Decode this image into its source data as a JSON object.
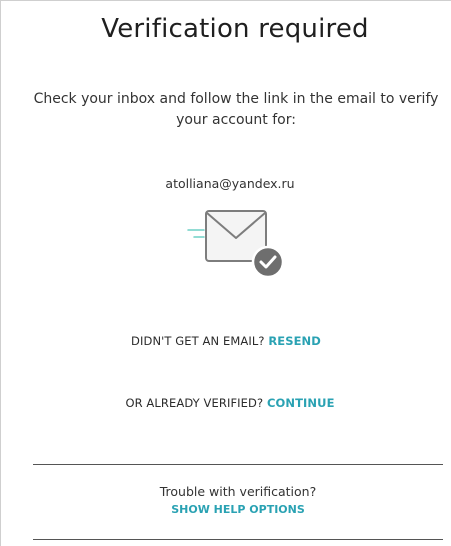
{
  "title": "Verification required",
  "instructions": "Check your inbox and follow the link in the email to verify your account for:",
  "email": "atolliana@yandex.ru",
  "illustration": {
    "icon": "envelope-check-icon",
    "colors": {
      "envelope_stroke": "#7d7d7d",
      "envelope_fill": "#f4f4f4",
      "check_circle": "#6e6e6e",
      "speed_lines": "#6fd0c6"
    }
  },
  "resend": {
    "prompt": "DIDN'T GET AN EMAIL?",
    "link": "RESEND"
  },
  "continue": {
    "prompt": "OR ALREADY VERIFIED?",
    "link": "CONTINUE"
  },
  "help": {
    "prompt": "Trouble with verification?",
    "link": "SHOW HELP OPTIONS"
  },
  "colors": {
    "accent": "#2aa2b3",
    "text": "#333333",
    "divider": "#555555"
  }
}
